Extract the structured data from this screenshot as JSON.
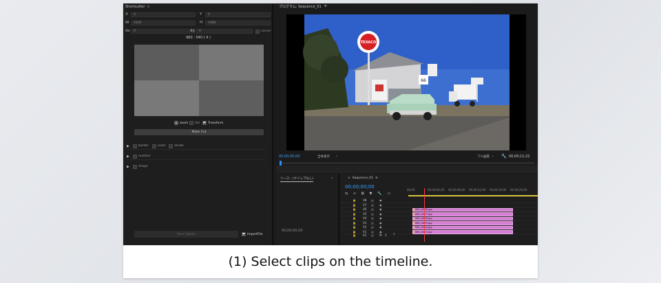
{
  "left_panel": {
    "tab_title": "Shortcutter",
    "fields": {
      "x_label": "X",
      "x_value": "0",
      "y_label": "Y",
      "y_value": "0",
      "w_label": "W",
      "w_value": "1920",
      "h_label": "H",
      "h_value": "1080",
      "dx_label": "dx",
      "dx_value": "0",
      "dy_label": "dy",
      "dy_value": "0",
      "corner_label": "corner"
    },
    "ratio_text": "960 : 540 ( 4 )",
    "mode_zoom": "zoom",
    "mode_full": "full",
    "transform_label": "Transform",
    "make_cut_label": "Make Cut",
    "sections": {
      "border": "border",
      "outer": "outer",
      "stroke": "stroke",
      "number": "number",
      "shape": "shape"
    },
    "save_option_label": "Save Option",
    "import_file_label": "ImportFile"
  },
  "program_monitor": {
    "tab_title": "プログラム: Sequence_01",
    "timecode": "00;00;00;00",
    "fit_label": "全体表示",
    "quality_label": "フル画質",
    "duration": "00;00;11;22"
  },
  "source_panel": {
    "tab_title": "ソース : (クリップなし)",
    "timecode": "00;00;00;00"
  },
  "timeline": {
    "tab_title": "Sequence_01",
    "timecode": "00;00;00;00",
    "ruler": [
      "00;00",
      "00;00;04;00",
      "00;00;08;00",
      "00;00;12;00",
      "00;00;16;00",
      "00;00;20;00"
    ],
    "tracks": [
      "V8",
      "V7",
      "V6",
      "V5",
      "V4",
      "V3",
      "V2",
      "V1",
      "A1"
    ],
    "clips": [
      "IMG_0008.jpg",
      "IMG_0007.jpg",
      "IMG_0006.jpg",
      "IMG_0005.jpg",
      "IMG_0004.jpg",
      "IMG_0003.jpg"
    ],
    "a1_m": "M",
    "a1_s": "S"
  },
  "caption": "(1) Select clips on the timeline."
}
